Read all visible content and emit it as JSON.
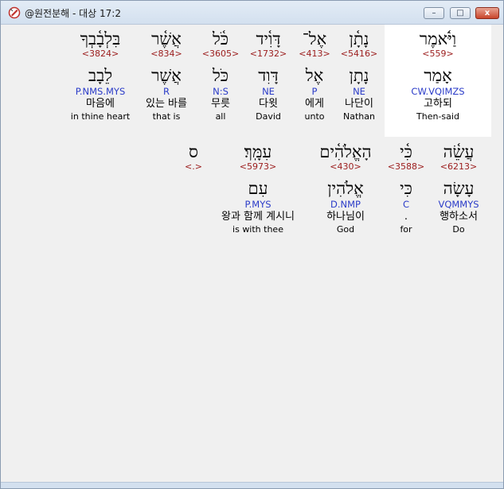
{
  "window": {
    "title": "@원전분해 - 대상 17:2",
    "minimize_label": "–",
    "maximize_label": "□",
    "close_label": "x"
  },
  "rows": [
    [
      {
        "heb": "וַיֹּ֫אמֶר",
        "strong": "<559>",
        "lemma": "אָמַר",
        "parse": "CW.VQIMZS",
        "korean": "고하되",
        "english": "Then-said"
      },
      {
        "heb": "נָתָ֫ן",
        "strong": "<5416>",
        "lemma": "נָתָן",
        "parse": "NE",
        "korean": "나단이",
        "english": "Nathan"
      },
      {
        "heb": "אֶל־",
        "strong": "<413>",
        "lemma": "אֶל",
        "parse": "P",
        "korean": "에게",
        "english": "unto"
      },
      {
        "heb": "דָּוִ֫יד",
        "strong": "<1732>",
        "lemma": "דָּוִד",
        "parse": "NE",
        "korean": "다윗",
        "english": "David"
      },
      {
        "heb": "כֹּ֫ל",
        "strong": "<3605>",
        "lemma": "כֹּל",
        "parse": "N:S",
        "korean": "무릇",
        "english": "all"
      },
      {
        "heb": "אֲשֶׁ֫ר",
        "strong": "<834>",
        "lemma": "אֲשֶׁר",
        "parse": "R",
        "korean": "있는 바를",
        "english": "that is"
      },
      {
        "heb": "בִּלְבָ֫בְךָ",
        "strong": "<3824>",
        "lemma": "לֵבָב",
        "parse": "P.NMS.MYS",
        "korean": "마음에",
        "english": "in thine heart"
      }
    ],
    [
      {
        "heb": "עֲשֵׂ֫ה",
        "strong": "<6213>",
        "lemma": "עָשָׂה",
        "parse": "VQMMYS",
        "korean": "행하소서",
        "english": "Do"
      },
      {
        "heb": "כִּ֫י",
        "strong": "<3588>",
        "lemma": "כִּי",
        "parse": "C",
        "korean": ".",
        "english": "for"
      },
      {
        "heb": "הָאֱלֹהִ֫ים",
        "strong": "<430>",
        "lemma": "אֱלֹהִין",
        "parse": "D.NMP",
        "korean": "하나님이",
        "english": "God"
      },
      {
        "heb": "עִמָּֽךְ׃",
        "strong": "<5973>",
        "lemma": "עִם",
        "parse": "P.MYS",
        "korean": "왕과 함께 계시니",
        "english": "is with thee"
      },
      {
        "heb": "ס",
        "strong": "<.>",
        "lemma": "",
        "parse": "",
        "korean": "",
        "english": ""
      }
    ]
  ]
}
